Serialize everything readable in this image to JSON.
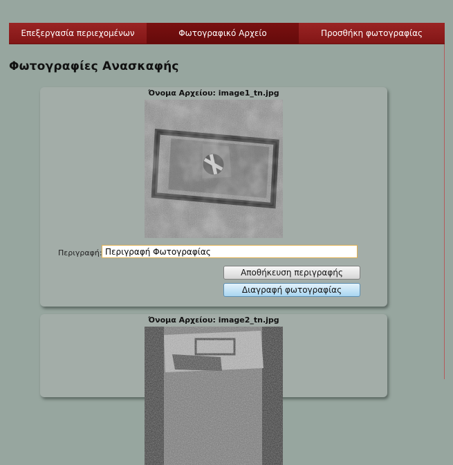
{
  "nav": {
    "tabs": [
      {
        "label": "Επεξεργασία περιεχομένων"
      },
      {
        "label": "Φωτογραφικό Αρχείο"
      },
      {
        "label": "Προσθήκη φωτογραφίας"
      }
    ]
  },
  "page": {
    "title": "Φωτογραφίες Ανασκαφής"
  },
  "photos": [
    {
      "filename_label": "Όνομα Αρχείου:",
      "filename": "image1_tn.jpg",
      "description_label": "Περιγραφή:",
      "description_value": "Περιγραφή Φωτογραφίας",
      "save_label": "Αποθήκευση περιγραφής",
      "delete_label": "Διαγραφή φωτογραφίας"
    },
    {
      "filename_label": "Όνομα Αρχείου:",
      "filename": "image2_tn.jpg"
    }
  ],
  "colors": {
    "background": "#97a69f",
    "nav_bar": "#8b1a1a",
    "nav_active": "#6e0d0d",
    "card": "#a3ada8",
    "input_border": "#e0b050",
    "delete_button": "#a9d6f1"
  }
}
